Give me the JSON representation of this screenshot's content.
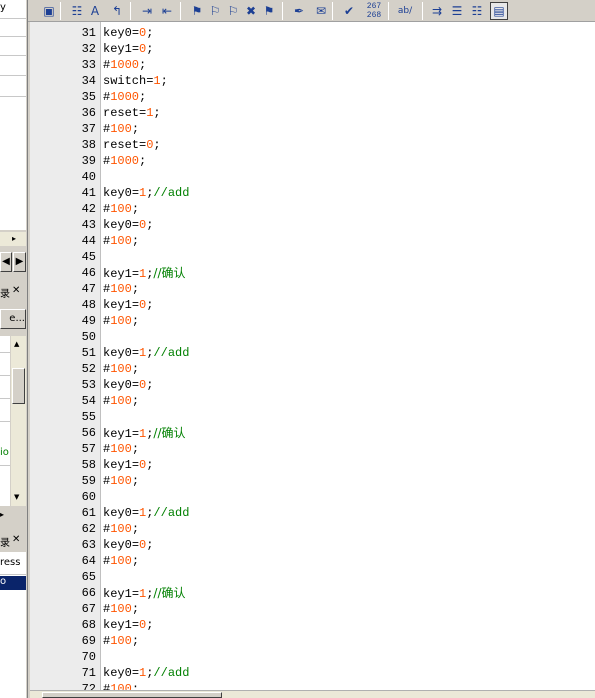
{
  "left_panel": {
    "partial_label_1": "y",
    "partial_button_1": "e...",
    "partial_text_green": "io",
    "partial_button_2": "ress",
    "partial_selected": "o",
    "panel_header_1": "录",
    "panel_header_2": "录",
    "close_glyph": "✕",
    "arrow_left": "◀",
    "arrow_right": "▶",
    "arrow_up": "▲",
    "arrow_down": "▼",
    "small_arrow": "▸"
  },
  "toolbar": {
    "buttons": [
      {
        "icon": "panel-icon",
        "glyph": "▣"
      },
      {
        "icon": "find-icon",
        "glyph": "☷"
      },
      {
        "icon": "replace-icon",
        "glyph": "A"
      },
      {
        "icon": "goto-icon",
        "glyph": "↰"
      },
      {
        "icon": "indent-icon",
        "glyph": "⇥"
      },
      {
        "icon": "unindent-icon",
        "glyph": "⇤"
      },
      {
        "icon": "bookmark-icon",
        "glyph": "⚑"
      },
      {
        "icon": "bookmark-next-icon",
        "glyph": "⚐"
      },
      {
        "icon": "bookmark-prev-icon",
        "glyph": "⚐"
      },
      {
        "icon": "bookmark-clear-icon",
        "glyph": "✖"
      },
      {
        "icon": "bookmark-list-icon",
        "glyph": "⚑"
      },
      {
        "icon": "attach-icon",
        "glyph": "✒"
      },
      {
        "icon": "script-icon",
        "glyph": "✉"
      },
      {
        "icon": "spellcheck-icon",
        "glyph": "✔"
      },
      {
        "icon": "line-compare-icon",
        "glyph": "≡"
      },
      {
        "icon": "spell-ab-icon",
        "glyph": "ab/"
      },
      {
        "icon": "wrap-icon",
        "glyph": "⇉"
      },
      {
        "icon": "column-icon",
        "glyph": "☰"
      },
      {
        "icon": "split-icon",
        "glyph": "☷"
      },
      {
        "icon": "view-icon",
        "glyph": "▤"
      }
    ],
    "line_counter_top": "267",
    "line_counter_bottom": "268"
  },
  "editor": {
    "lines": [
      {
        "n": "31",
        "code": "key0",
        "op": "=",
        "val": "0",
        "end": ";",
        "cmt": ""
      },
      {
        "n": "32",
        "code": "key1",
        "op": "=",
        "val": "0",
        "end": ";",
        "cmt": ""
      },
      {
        "n": "33",
        "code": "#",
        "op": "",
        "val": "1000",
        "end": ";",
        "cmt": ""
      },
      {
        "n": "34",
        "code": "switch",
        "op": "=",
        "val": "1",
        "end": ";",
        "cmt": ""
      },
      {
        "n": "35",
        "code": "#",
        "op": "",
        "val": "1000",
        "end": ";",
        "cmt": ""
      },
      {
        "n": "36",
        "code": "reset",
        "op": "=",
        "val": "1",
        "end": ";",
        "cmt": ""
      },
      {
        "n": "37",
        "code": "#",
        "op": "",
        "val": "100",
        "end": ";",
        "cmt": ""
      },
      {
        "n": "38",
        "code": "reset",
        "op": "=",
        "val": "0",
        "end": ";",
        "cmt": ""
      },
      {
        "n": "39",
        "code": "#",
        "op": "",
        "val": "1000",
        "end": ";",
        "cmt": ""
      },
      {
        "n": "40",
        "code": "",
        "op": "",
        "val": "",
        "end": "",
        "cmt": ""
      },
      {
        "n": "41",
        "code": "key0",
        "op": "=",
        "val": "1",
        "end": ";",
        "cmt": "//add"
      },
      {
        "n": "42",
        "code": "#",
        "op": "",
        "val": "100",
        "end": ";",
        "cmt": ""
      },
      {
        "n": "43",
        "code": "key0",
        "op": "=",
        "val": "0",
        "end": ";",
        "cmt": ""
      },
      {
        "n": "44",
        "code": "#",
        "op": "",
        "val": "100",
        "end": ";",
        "cmt": ""
      },
      {
        "n": "45",
        "code": "",
        "op": "",
        "val": "",
        "end": "",
        "cmt": ""
      },
      {
        "n": "46",
        "code": "key1",
        "op": "=",
        "val": "1",
        "end": ";",
        "cmt": "//确认"
      },
      {
        "n": "47",
        "code": "#",
        "op": "",
        "val": "100",
        "end": ";",
        "cmt": ""
      },
      {
        "n": "48",
        "code": "key1",
        "op": "=",
        "val": "0",
        "end": ";",
        "cmt": ""
      },
      {
        "n": "49",
        "code": "#",
        "op": "",
        "val": "100",
        "end": ";",
        "cmt": ""
      },
      {
        "n": "50",
        "code": "",
        "op": "",
        "val": "",
        "end": "",
        "cmt": ""
      },
      {
        "n": "51",
        "code": "key0",
        "op": "=",
        "val": "1",
        "end": ";",
        "cmt": "//add"
      },
      {
        "n": "52",
        "code": "#",
        "op": "",
        "val": "100",
        "end": ";",
        "cmt": ""
      },
      {
        "n": "53",
        "code": "key0",
        "op": "=",
        "val": "0",
        "end": ";",
        "cmt": ""
      },
      {
        "n": "54",
        "code": "#",
        "op": "",
        "val": "100",
        "end": ";",
        "cmt": ""
      },
      {
        "n": "55",
        "code": "",
        "op": "",
        "val": "",
        "end": "",
        "cmt": ""
      },
      {
        "n": "56",
        "code": "key1",
        "op": "=",
        "val": "1",
        "end": ";",
        "cmt": "//确认"
      },
      {
        "n": "57",
        "code": "#",
        "op": "",
        "val": "100",
        "end": ";",
        "cmt": ""
      },
      {
        "n": "58",
        "code": "key1",
        "op": "=",
        "val": "0",
        "end": ";",
        "cmt": ""
      },
      {
        "n": "59",
        "code": "#",
        "op": "",
        "val": "100",
        "end": ";",
        "cmt": ""
      },
      {
        "n": "60",
        "code": "",
        "op": "",
        "val": "",
        "end": "",
        "cmt": ""
      },
      {
        "n": "61",
        "code": "key0",
        "op": "=",
        "val": "1",
        "end": ";",
        "cmt": "//add"
      },
      {
        "n": "62",
        "code": "#",
        "op": "",
        "val": "100",
        "end": ";",
        "cmt": ""
      },
      {
        "n": "63",
        "code": "key0",
        "op": "=",
        "val": "0",
        "end": ";",
        "cmt": ""
      },
      {
        "n": "64",
        "code": "#",
        "op": "",
        "val": "100",
        "end": ";",
        "cmt": ""
      },
      {
        "n": "65",
        "code": "",
        "op": "",
        "val": "",
        "end": "",
        "cmt": ""
      },
      {
        "n": "66",
        "code": "key1",
        "op": "=",
        "val": "1",
        "end": ";",
        "cmt": "//确认"
      },
      {
        "n": "67",
        "code": "#",
        "op": "",
        "val": "100",
        "end": ";",
        "cmt": ""
      },
      {
        "n": "68",
        "code": "key1",
        "op": "=",
        "val": "0",
        "end": ";",
        "cmt": ""
      },
      {
        "n": "69",
        "code": "#",
        "op": "",
        "val": "100",
        "end": ";",
        "cmt": ""
      },
      {
        "n": "70",
        "code": "",
        "op": "",
        "val": "",
        "end": "",
        "cmt": ""
      },
      {
        "n": "71",
        "code": "key0",
        "op": "=",
        "val": "1",
        "end": ";",
        "cmt": "//add"
      },
      {
        "n": "72",
        "code": "#",
        "op": "",
        "val": "100",
        "end": ";",
        "cmt": ""
      }
    ]
  },
  "colors": {
    "number": "#ff5500",
    "comment": "#008000",
    "selection": "#0a246a"
  }
}
